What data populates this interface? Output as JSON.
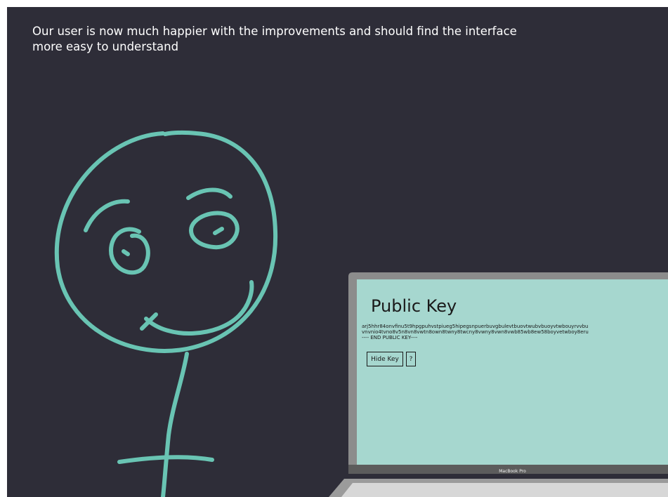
{
  "caption": {
    "line1": "Our user is now much happier with the improvements and should find the interface",
    "line2": "more easy to understand"
  },
  "laptop": {
    "screen": {
      "title": "Public Key",
      "key_line1": "arj5hhr84onvfinu5t9hpgpuhvstpiueg5hipegsnpuerbuvgbulevtbuovtwubvbuoyvtwbouyrvvbu",
      "key_line2": "vnvnio4tvno8v5n8vn8vwtn8own8twny8twcny8vwny8vwn8vwb85wb8ew58boyvetwboy8eru",
      "key_line3": "---- END PUBLIC KEY----",
      "hide_button": "Hide Key",
      "help_button": "?"
    },
    "brand_label": "MacBook Pro"
  },
  "colors": {
    "background": "#2e2d38",
    "sketch_stroke": "#69c4b3",
    "screen": "#a6d7cf",
    "bezel": "#8c8c8c"
  }
}
